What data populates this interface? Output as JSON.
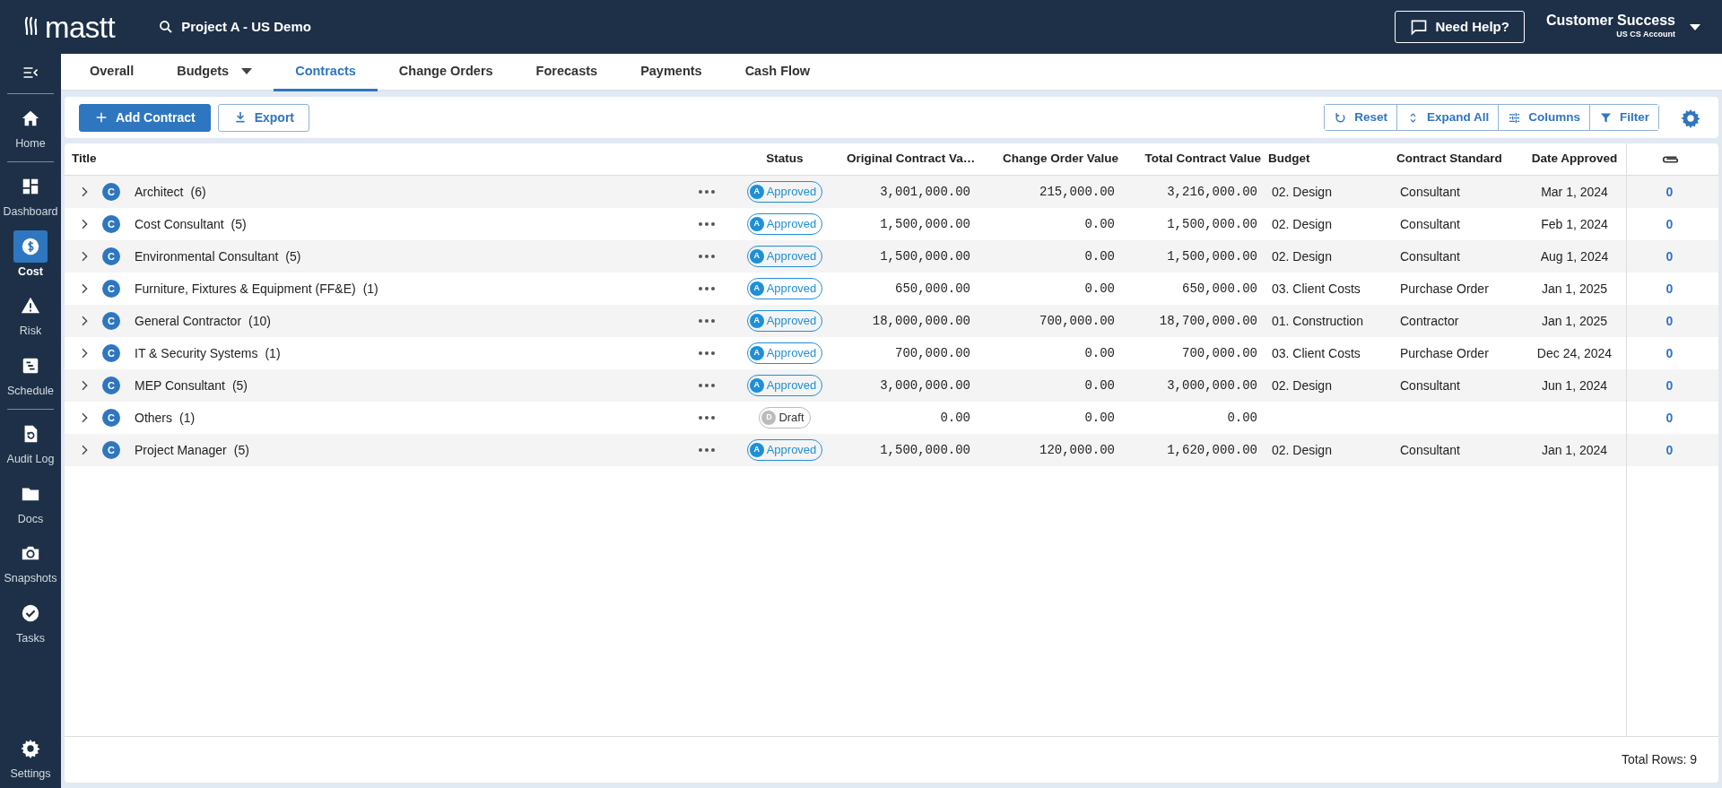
{
  "app": {
    "logo": "mastt",
    "project": "Project A - US Demo",
    "help_button": "Need Help?",
    "user_name": "Customer Success",
    "account": "US CS Account"
  },
  "sidebar": {
    "groups": [
      [
        {
          "label": "Home",
          "selected": false
        }
      ],
      [
        {
          "label": "Dashboard",
          "selected": false
        },
        {
          "label": "Cost",
          "selected": true
        },
        {
          "label": "Risk",
          "selected": false
        },
        {
          "label": "Schedule",
          "selected": false
        }
      ],
      [
        {
          "label": "Audit Log",
          "selected": false
        },
        {
          "label": "Docs",
          "selected": false
        },
        {
          "label": "Snapshots",
          "selected": false
        },
        {
          "label": "Tasks",
          "selected": false
        }
      ]
    ],
    "bottom": {
      "label": "Settings",
      "selected": false
    }
  },
  "tabs": [
    {
      "label": "Overall",
      "selected": false,
      "has_menu": false
    },
    {
      "label": "Budgets",
      "selected": false,
      "has_menu": true
    },
    {
      "label": "Contracts",
      "selected": true,
      "has_menu": false
    },
    {
      "label": "Change Orders",
      "selected": false,
      "has_menu": false
    },
    {
      "label": "Forecasts",
      "selected": false,
      "has_menu": false
    },
    {
      "label": "Payments",
      "selected": false,
      "has_menu": false
    },
    {
      "label": "Cash Flow",
      "selected": false,
      "has_menu": false
    }
  ],
  "toolbar": {
    "primary": "Add Contract",
    "export": "Export",
    "view_actions": [
      "Reset",
      "Expand All",
      "Columns",
      "Filter"
    ]
  },
  "table": {
    "columns": [
      "Title",
      "Status",
      "Original Contract Va…",
      "Change Order Value",
      "Total Contract Value",
      "Budget",
      "Contract Standard",
      "Date Approved"
    ],
    "rows": [
      {
        "type": "C",
        "title": "Architect",
        "count": "(6)",
        "status": {
          "kind": "approved",
          "letter": "A",
          "label": "Approved"
        },
        "original": "3,001,000.00",
        "change": "215,000.00",
        "total": "3,216,000.00",
        "budget": "02. Design",
        "standard": "Consultant",
        "date": "Mar 1, 2024",
        "attachments": "0"
      },
      {
        "type": "C",
        "title": "Cost Consultant",
        "count": "(5)",
        "status": {
          "kind": "approved",
          "letter": "A",
          "label": "Approved"
        },
        "original": "1,500,000.00",
        "change": "0.00",
        "total": "1,500,000.00",
        "budget": "02. Design",
        "standard": "Consultant",
        "date": "Feb 1, 2024",
        "attachments": "0"
      },
      {
        "type": "C",
        "title": "Environmental Consultant",
        "count": "(5)",
        "status": {
          "kind": "approved",
          "letter": "A",
          "label": "Approved"
        },
        "original": "1,500,000.00",
        "change": "0.00",
        "total": "1,500,000.00",
        "budget": "02. Design",
        "standard": "Consultant",
        "date": "Aug 1, 2024",
        "attachments": "0"
      },
      {
        "type": "C",
        "title": "Furniture, Fixtures & Equipment (FF&E)",
        "count": "(1)",
        "status": {
          "kind": "approved",
          "letter": "A",
          "label": "Approved"
        },
        "original": "650,000.00",
        "change": "0.00",
        "total": "650,000.00",
        "budget": "03. Client Costs",
        "standard": "Purchase Order",
        "date": "Jan 1, 2025",
        "attachments": "0"
      },
      {
        "type": "C",
        "title": "General Contractor",
        "count": "(10)",
        "status": {
          "kind": "approved",
          "letter": "A",
          "label": "Approved"
        },
        "original": "18,000,000.00",
        "change": "700,000.00",
        "total": "18,700,000.00",
        "budget": "01. Construction",
        "standard": "Contractor",
        "date": "Jan 1, 2025",
        "attachments": "0"
      },
      {
        "type": "C",
        "title": "IT & Security Systems",
        "count": "(1)",
        "status": {
          "kind": "approved",
          "letter": "A",
          "label": "Approved"
        },
        "original": "700,000.00",
        "change": "0.00",
        "total": "700,000.00",
        "budget": "03. Client Costs",
        "standard": "Purchase Order",
        "date": "Dec 24, 2024",
        "attachments": "0"
      },
      {
        "type": "C",
        "title": "MEP Consultant",
        "count": "(5)",
        "status": {
          "kind": "approved",
          "letter": "A",
          "label": "Approved"
        },
        "original": "3,000,000.00",
        "change": "0.00",
        "total": "3,000,000.00",
        "budget": "02. Design",
        "standard": "Consultant",
        "date": "Jun 1, 2024",
        "attachments": "0"
      },
      {
        "type": "C",
        "title": "Others",
        "count": "(1)",
        "status": {
          "kind": "draft",
          "letter": "D",
          "label": "Draft"
        },
        "original": "0.00",
        "change": "0.00",
        "total": "0.00",
        "attachments": "0"
      },
      {
        "type": "C",
        "title": "Project Manager",
        "count": "(5)",
        "status": {
          "kind": "approved",
          "letter": "A",
          "label": "Approved"
        },
        "original": "1,500,000.00",
        "change": "120,000.00",
        "total": "1,620,000.00",
        "budget": "02. Design",
        "standard": "Consultant",
        "date": "Jan 1, 2024",
        "attachments": "0"
      }
    ]
  },
  "footer": {
    "total_rows": "Total Rows: 9"
  }
}
